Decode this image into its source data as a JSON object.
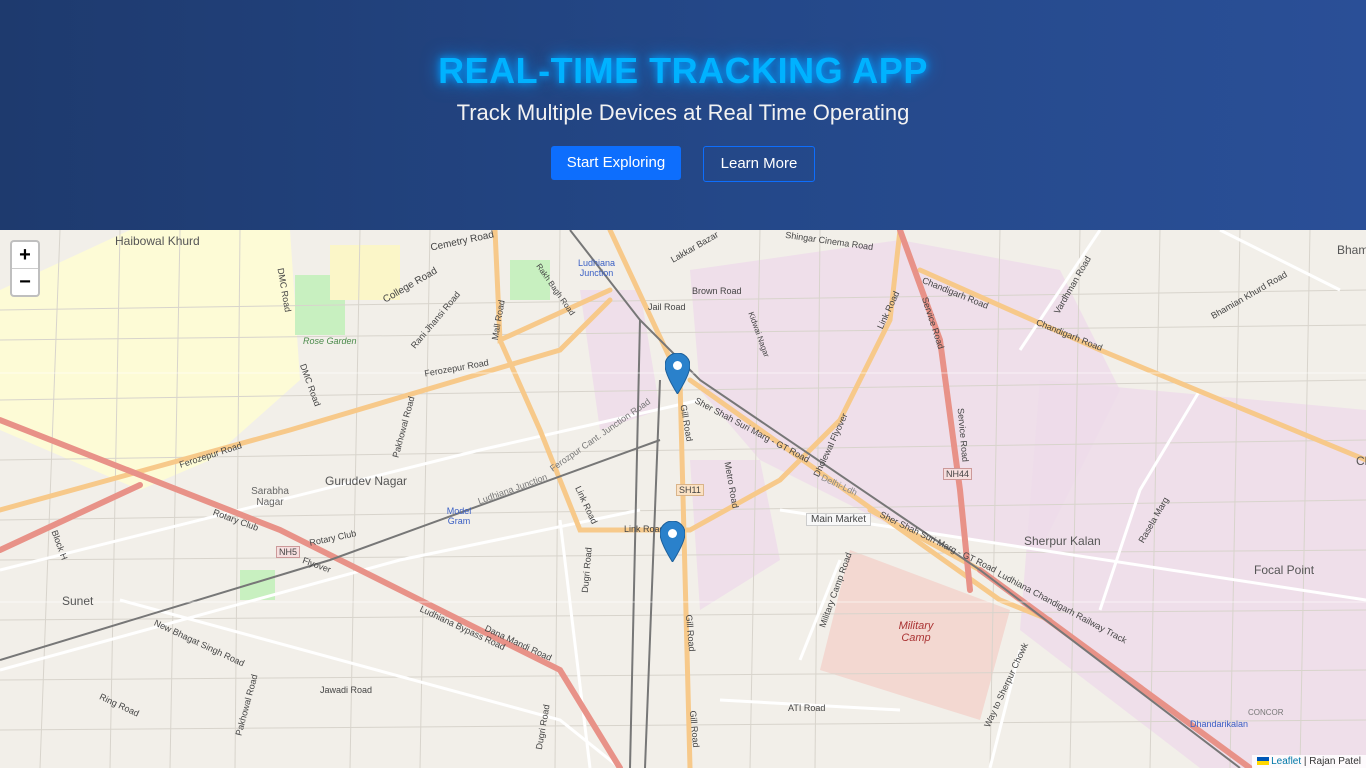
{
  "hero": {
    "title": "REAL-TIME TRACKING APP",
    "subtitle": "Track Multiple Devices at Real Time Operating",
    "primary_button": "Start Exploring",
    "secondary_button": "Learn More"
  },
  "map": {
    "zoom_in": "+",
    "zoom_out": "−",
    "attribution_link": "Leaflet",
    "attribution_sep": " | ",
    "attribution_author": "Rajan Patel",
    "markers": [
      {
        "name": "device-marker-1"
      },
      {
        "name": "device-marker-2"
      }
    ],
    "labels": {
      "haibowal": "Haibowal Khurd",
      "cemetry": "Cemetry Road",
      "college": "College Road",
      "ludhiana_junction": "Ludhiana Junction",
      "rakh_bagh": "Rakh Bagh Road",
      "lakkar": "Lakkar Bazar",
      "shingar": "Shingar Cinema Road",
      "brown": "Brown Road",
      "jail": "Jail Road",
      "kidwai": "Kidwai Nagar",
      "dmc": "DMC Road",
      "rose_garden": "Rose Garden",
      "rani_jhansi": "Rani Jhansi Road",
      "mall": "Mall Road",
      "ferozepur": "Ferozepur Road",
      "ferozepur2": "Ferozepur Road",
      "dmc2": "DMC Road",
      "pakhowal": "Pakhowal Road",
      "gurudev": "Gurudev Nagar",
      "sarabha": "Sarabha Nagar",
      "rotary1": "Rotary Club",
      "rotary2": "Rotary Club",
      "model_gram": "Model Gram",
      "lud_junction2": "Ludhiana Junction",
      "ferozpur_cant": "Ferozpur Cant. Junction Road",
      "link1": "Link Road",
      "link2": "Link Road",
      "gill1": "Gill Road",
      "gill2": "Gill Road",
      "gill3": "Gill Road",
      "metro": "Metro Road",
      "sher_shah1": "Sher Shah Suri Marg - GT Road",
      "sher_shah2": "Sher Shah Suri Marg - GT Road",
      "dholewal": "Dholewal Flyover",
      "delhi_ldh": "Delhi-Ldh",
      "main_market": "Main Market",
      "chandigarh1": "Chandigarh Road",
      "chandigarh2": "Chandigarh Road",
      "link3": "Link Road",
      "service1": "Service Road",
      "service2": "Service Road",
      "vardhman": "Vardhman Road",
      "bhamian": "Bhamian Khurd Road",
      "sherpur": "Sherpur Kalan",
      "focal": "Focal Point",
      "rasela": "Rasela Marg",
      "military_camp_road": "Military Camp Road",
      "military_camp": "Military Camp",
      "way_sherpur": "Way to Sherpur Chowk",
      "lud_chd_rail": "Ludhiana Chandigarh Railway Track",
      "dhandari": "Dhandarikalan",
      "concor": "CONCOR",
      "sunet": "Sunet",
      "new_bhagat": "New Bhagat Singh Road",
      "jawadi": "Jawadi Road",
      "dana_mandi": "Dana Mandi Road",
      "bypass": "Ludhiana Bypass Road",
      "flyover": "Flyover",
      "ring": "Ring Road",
      "pakhowal2": "Pakhowal Road",
      "dugri1": "Dugri Road",
      "dugri2": "Dugri Road",
      "ati": "ATI Road",
      "block_h": "Block H",
      "bham": "Bham",
      "sh11": "SH11",
      "nh44": "NH44",
      "nh5": "NH5",
      "ch": "Ch"
    }
  }
}
